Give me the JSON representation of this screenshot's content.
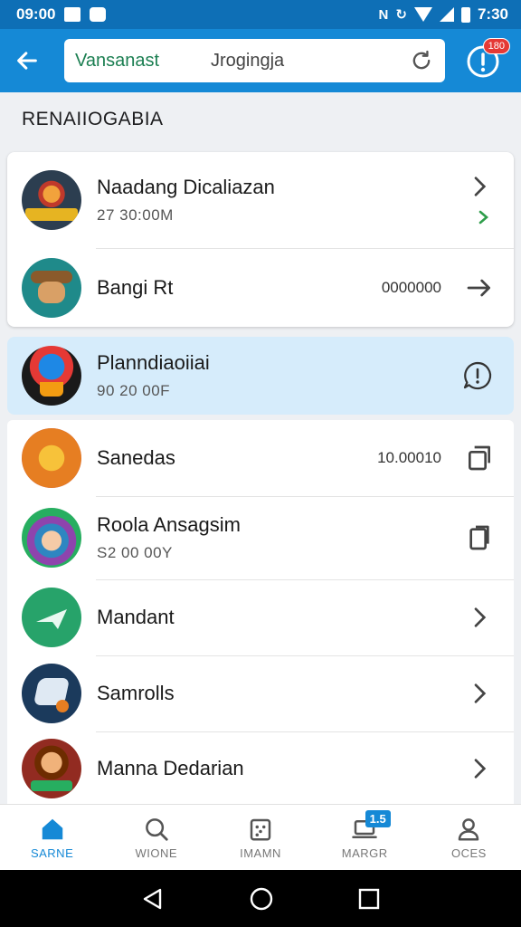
{
  "status_bar": {
    "time": "09:00",
    "clock_right": "7:30"
  },
  "app_bar": {
    "search_scope": "Vansanast",
    "search_value": "Jrogingja",
    "info_badge": "180"
  },
  "section_title": "RENAIIOGABIA",
  "cards": [
    {
      "rows": [
        {
          "title": "Naadang Dicaliazan",
          "subtitle": "27 30:00M",
          "value": "",
          "trailing_icon": "chevron-right-icon"
        },
        {
          "title": "Bangi Rt",
          "subtitle": "",
          "value": "0000000",
          "trailing_icon": "arrow-right-icon"
        }
      ]
    },
    {
      "rows": [
        {
          "title": "Planndiaoiiai",
          "subtitle": "90 20 00F",
          "value": "",
          "trailing_icon": "feedback-icon"
        }
      ]
    },
    {
      "rows": [
        {
          "title": "Sanedas",
          "subtitle": "",
          "value": "10.00010",
          "trailing_icon": "copy-icon"
        },
        {
          "title": "Roola Ansagsim",
          "subtitle": "S2 00 00Y",
          "value": "",
          "trailing_icon": "document-icon"
        },
        {
          "title": "Mandant",
          "subtitle": "",
          "value": "",
          "trailing_icon": "chevron-right-icon"
        },
        {
          "title": "Samrolls",
          "subtitle": "",
          "value": "",
          "trailing_icon": "chevron-right-icon"
        },
        {
          "title": "Manna Dedarian",
          "subtitle": "",
          "value": "",
          "trailing_icon": "chevron-right-icon"
        }
      ]
    }
  ],
  "bottom_nav": [
    {
      "label": "SARNE",
      "icon": "home-icon",
      "active": true
    },
    {
      "label": "WIONE",
      "icon": "search-icon",
      "active": false
    },
    {
      "label": "IMAMN",
      "icon": "dice-icon",
      "active": false
    },
    {
      "label": "MARGR",
      "icon": "laptop-icon",
      "active": false,
      "badge": "1.5"
    },
    {
      "label": "OCES",
      "icon": "profile-icon",
      "active": false
    }
  ],
  "colors": {
    "primary": "#1589d6",
    "status_bar": "#0e6fb6",
    "highlight_row": "#d6ecfb",
    "badge_red": "#e53935",
    "accent_green": "#2e9d4a"
  }
}
